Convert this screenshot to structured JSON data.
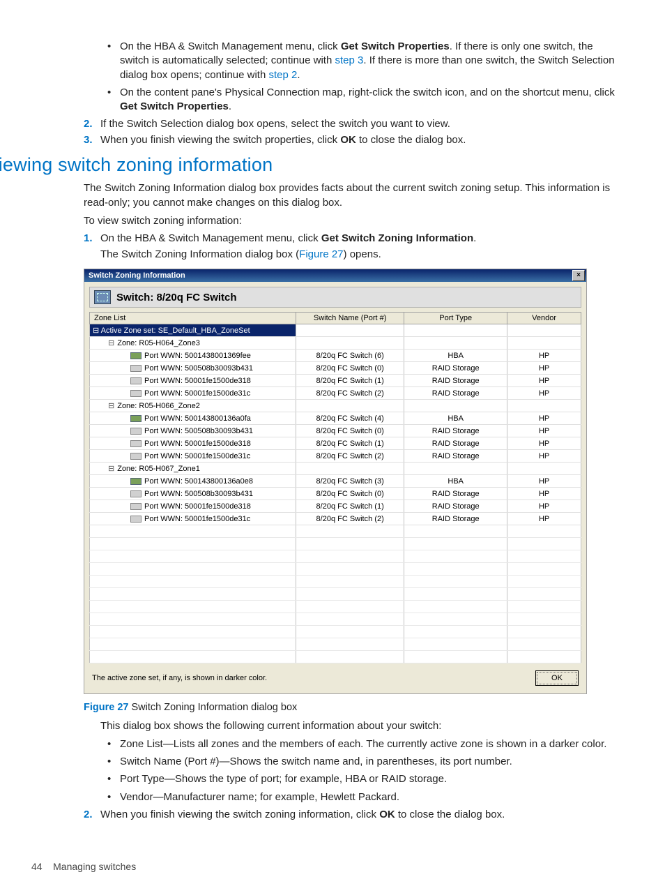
{
  "intro_bullets": [
    {
      "pre": "On the HBA & Switch Management menu, click ",
      "bold": "Get Switch Properties",
      "post_a": ". If there is only one switch, the switch is automatically selected; continue with ",
      "link1": "step 3",
      "post_b": ". If there is more than one switch, the Switch Selection dialog box opens; continue with ",
      "link2": "step 2",
      "post_c": "."
    },
    {
      "pre": "On the content pane's Physical Connection map, right-click the switch icon, and on the shortcut menu, click ",
      "bold": "Get Switch Properties",
      "post_a": "."
    }
  ],
  "intro_steps": {
    "s2": "If the Switch Selection dialog box opens, select the switch you want to view.",
    "s3_pre": "When you finish viewing the switch properties, click ",
    "s3_bold": "OK",
    "s3_post": " to close the dialog box."
  },
  "heading": "Viewing switch zoning information",
  "para1": "The Switch Zoning Information dialog box provides facts about the current switch zoning setup. This information is read-only; you cannot make changes on this dialog box.",
  "para2": "To view switch zoning information:",
  "step1": {
    "pre": "On the HBA & Switch Management menu, click ",
    "bold": "Get Switch Zoning Information",
    "post": ".",
    "sub_pre": "The Switch Zoning Information dialog box (",
    "sub_link": "Figure 27",
    "sub_post": ") opens."
  },
  "dialog": {
    "title": "Switch Zoning Information",
    "close": "×",
    "switch_label": "Switch: 8/20q FC Switch",
    "headers": [
      "Zone List",
      "Switch Name (Port #)",
      "Port Type",
      "Vendor"
    ],
    "active_zoneset": "Active Zone set: SE_Default_HBA_ZoneSet",
    "zones": [
      {
        "name": "Zone: R05-H064_Zone3",
        "ports": [
          {
            "wwn": "Port WWN: 5001438001369fee",
            "sw": "8/20q FC Switch (6)",
            "type": "HBA",
            "vendor": "HP",
            "icon": "hba"
          },
          {
            "wwn": "Port WWN: 500508b30093b431",
            "sw": "8/20q FC Switch (0)",
            "type": "RAID Storage",
            "vendor": "HP",
            "icon": "raid"
          },
          {
            "wwn": "Port WWN: 50001fe1500de318",
            "sw": "8/20q FC Switch (1)",
            "type": "RAID Storage",
            "vendor": "HP",
            "icon": "raid"
          },
          {
            "wwn": "Port WWN: 50001fe1500de31c",
            "sw": "8/20q FC Switch (2)",
            "type": "RAID Storage",
            "vendor": "HP",
            "icon": "raid"
          }
        ]
      },
      {
        "name": "Zone: R05-H066_Zone2",
        "ports": [
          {
            "wwn": "Port WWN: 500143800136a0fa",
            "sw": "8/20q FC Switch (4)",
            "type": "HBA",
            "vendor": "HP",
            "icon": "hba"
          },
          {
            "wwn": "Port WWN: 500508b30093b431",
            "sw": "8/20q FC Switch (0)",
            "type": "RAID Storage",
            "vendor": "HP",
            "icon": "raid"
          },
          {
            "wwn": "Port WWN: 50001fe1500de318",
            "sw": "8/20q FC Switch (1)",
            "type": "RAID Storage",
            "vendor": "HP",
            "icon": "raid"
          },
          {
            "wwn": "Port WWN: 50001fe1500de31c",
            "sw": "8/20q FC Switch (2)",
            "type": "RAID Storage",
            "vendor": "HP",
            "icon": "raid"
          }
        ]
      },
      {
        "name": "Zone: R05-H067_Zone1",
        "ports": [
          {
            "wwn": "Port WWN: 500143800136a0e8",
            "sw": "8/20q FC Switch (3)",
            "type": "HBA",
            "vendor": "HP",
            "icon": "hba"
          },
          {
            "wwn": "Port WWN: 500508b30093b431",
            "sw": "8/20q FC Switch (0)",
            "type": "RAID Storage",
            "vendor": "HP",
            "icon": "raid"
          },
          {
            "wwn": "Port WWN: 50001fe1500de318",
            "sw": "8/20q FC Switch (1)",
            "type": "RAID Storage",
            "vendor": "HP",
            "icon": "raid"
          },
          {
            "wwn": "Port WWN: 50001fe1500de31c",
            "sw": "8/20q FC Switch (2)",
            "type": "RAID Storage",
            "vendor": "HP",
            "icon": "raid"
          }
        ]
      }
    ],
    "empty_rows": 11,
    "note": "The active zone set, if any, is shown in darker color.",
    "ok": "OK"
  },
  "caption": {
    "label": "Figure 27",
    "text": " Switch Zoning Information dialog box"
  },
  "after_para": "This dialog box shows the following current information about your switch:",
  "after_bullets": [
    "Zone List—Lists all zones and the members of each. The currently active zone is shown in a darker color.",
    "Switch Name (Port #)—Shows the switch name and, in parentheses, its port number.",
    "Port Type—Shows the type of port; for example, HBA or RAID storage.",
    "Vendor—Manufacturer name; for example, Hewlett Packard."
  ],
  "step2": {
    "pre": "When you finish viewing the switch zoning information, click ",
    "bold": "OK",
    "post": " to close the dialog box."
  },
  "footer": {
    "page": "44",
    "section": "Managing switches"
  }
}
